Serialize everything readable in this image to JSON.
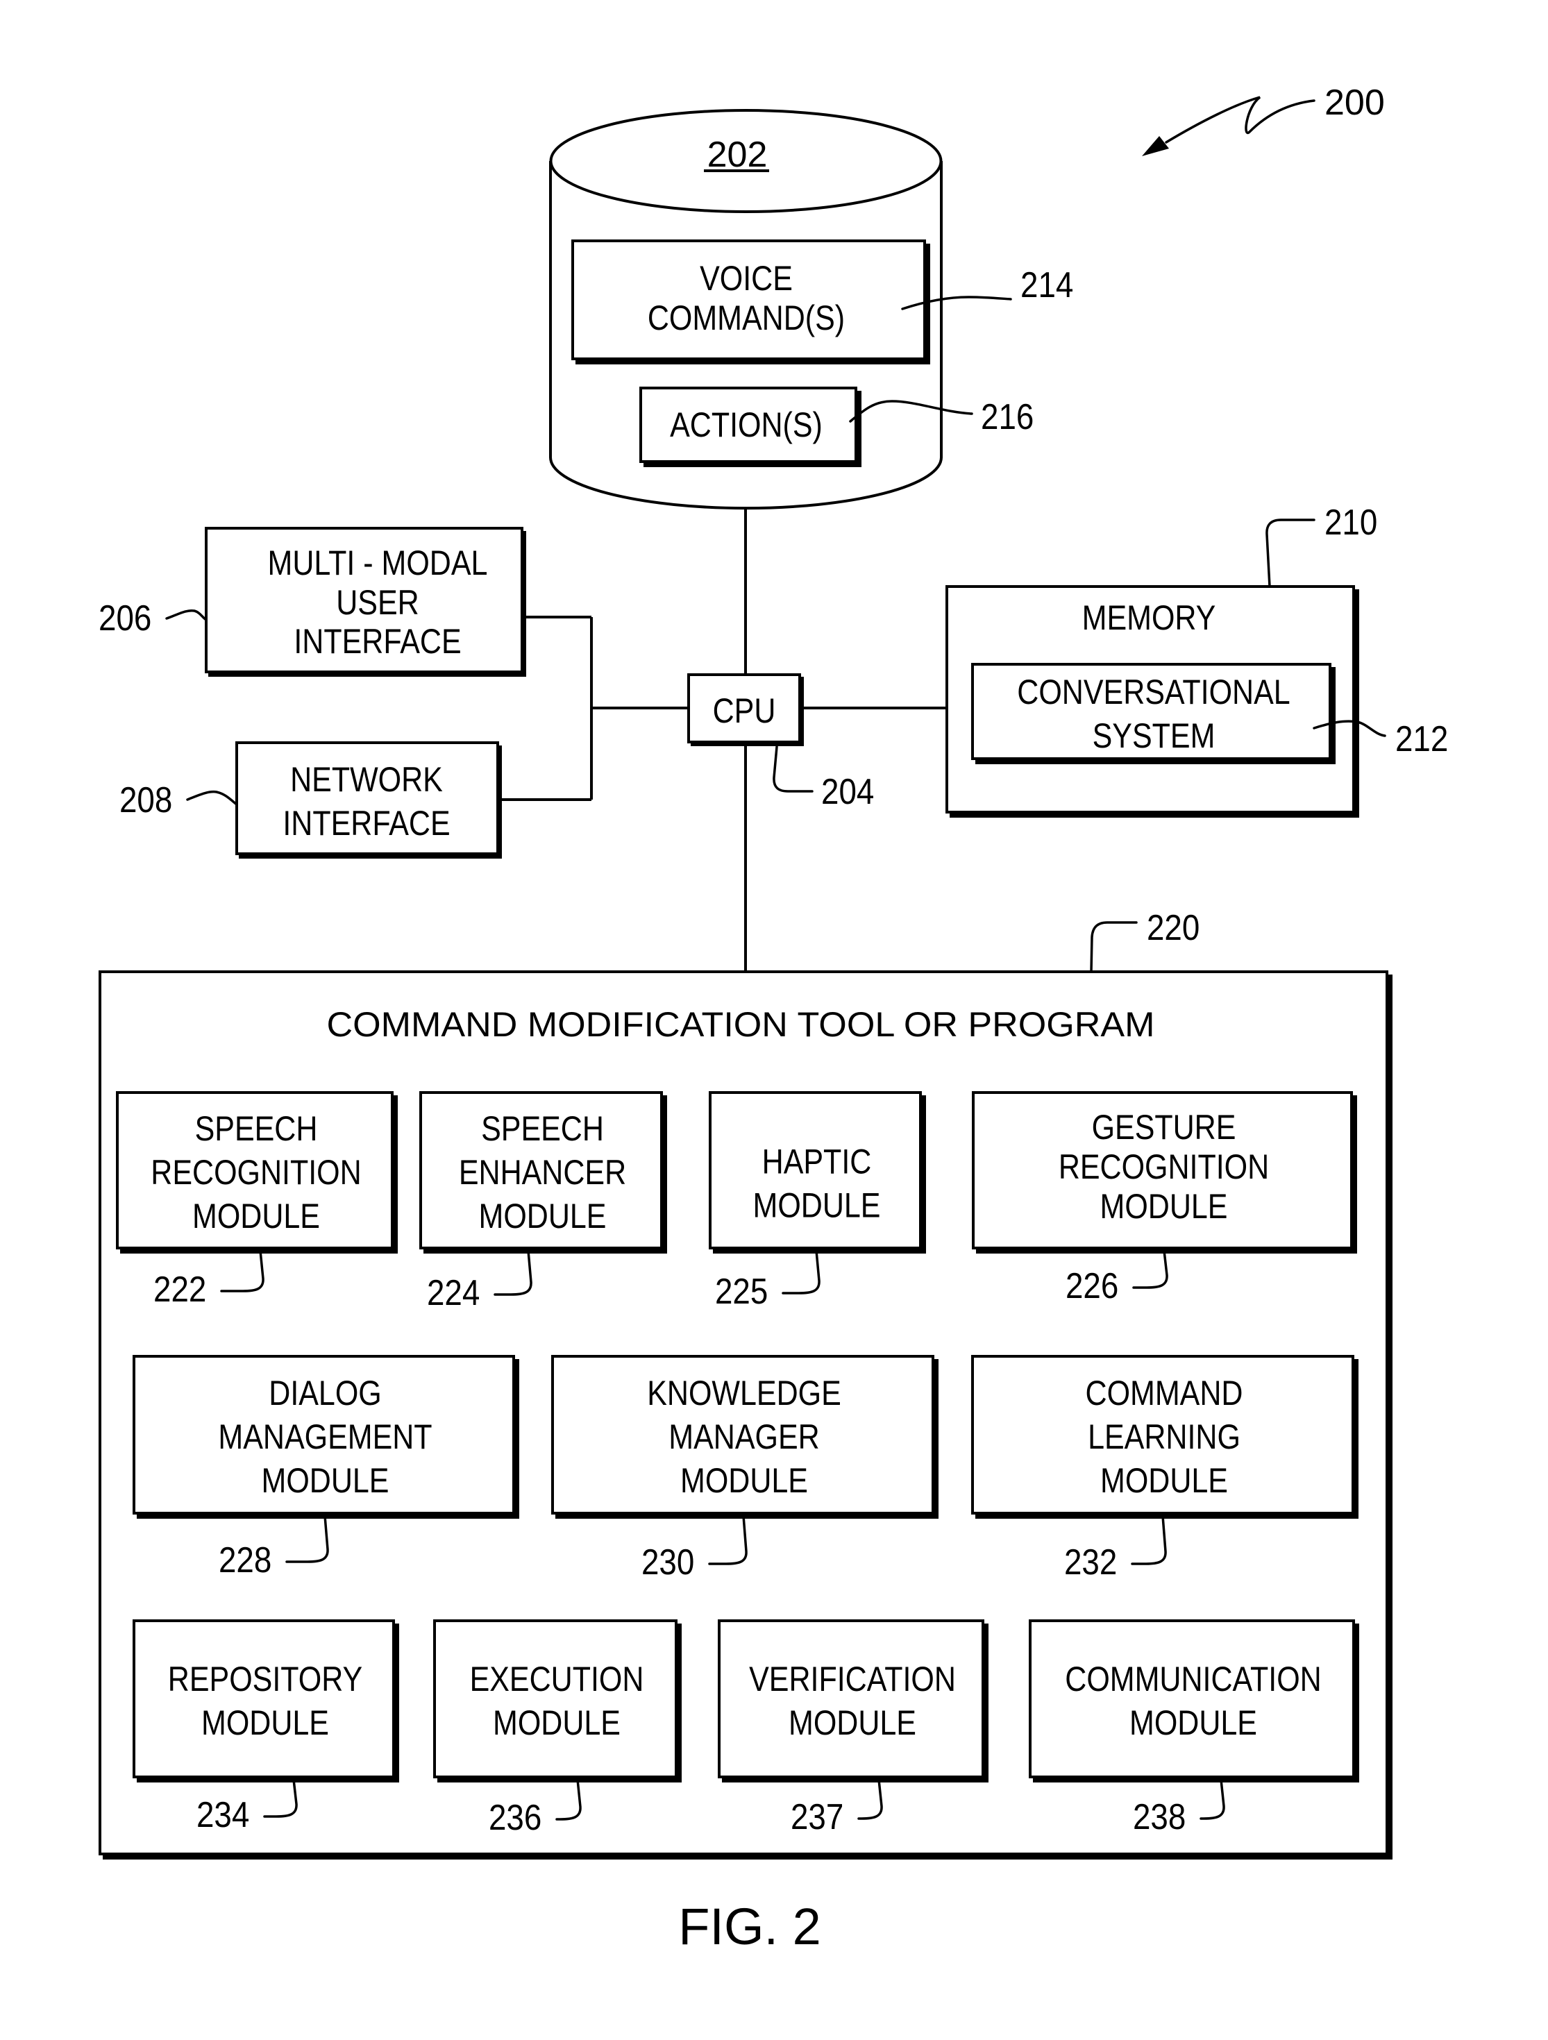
{
  "figure": {
    "caption": "FIG. 2",
    "system_ref": "200"
  },
  "database": {
    "ref": "202",
    "voice_commands": {
      "lines": [
        "VOICE",
        "COMMAND(S)"
      ],
      "ref": "214"
    },
    "actions": {
      "lines": [
        "ACTION(S)"
      ],
      "ref": "216"
    }
  },
  "cpu": {
    "label": "CPU",
    "ref": "204"
  },
  "multimodal_ui": {
    "lines": [
      "MULTI - MODAL",
      "USER",
      "INTERFACE"
    ],
    "ref": "206"
  },
  "network_interface": {
    "lines": [
      "NETWORK",
      "INTERFACE"
    ],
    "ref": "208"
  },
  "memory": {
    "label": "MEMORY",
    "ref": "210",
    "conversational_system": {
      "lines": [
        "CONVERSATIONAL",
        "SYSTEM"
      ],
      "ref": "212"
    }
  },
  "tool": {
    "title": "COMMAND MODIFICATION TOOL OR PROGRAM",
    "ref": "220",
    "modules": [
      {
        "lines": [
          "SPEECH",
          "RECOGNITION",
          "MODULE"
        ],
        "ref": "222"
      },
      {
        "lines": [
          "SPEECH",
          "ENHANCER",
          "MODULE"
        ],
        "ref": "224"
      },
      {
        "lines": [
          "HAPTIC",
          "MODULE"
        ],
        "ref": "225"
      },
      {
        "lines": [
          "GESTURE",
          "RECOGNITION",
          "MODULE"
        ],
        "ref": "226"
      },
      {
        "lines": [
          "DIALOG",
          "MANAGEMENT",
          "MODULE"
        ],
        "ref": "228"
      },
      {
        "lines": [
          "KNOWLEDGE",
          "MANAGER",
          "MODULE"
        ],
        "ref": "230"
      },
      {
        "lines": [
          "COMMAND",
          "LEARNING",
          "MODULE"
        ],
        "ref": "232"
      },
      {
        "lines": [
          "REPOSITORY",
          "MODULE"
        ],
        "ref": "234"
      },
      {
        "lines": [
          "EXECUTION",
          "MODULE"
        ],
        "ref": "236"
      },
      {
        "lines": [
          "VERIFICATION",
          "MODULE"
        ],
        "ref": "237"
      },
      {
        "lines": [
          "COMMUNICATION",
          "MODULE"
        ],
        "ref": "238"
      }
    ]
  }
}
